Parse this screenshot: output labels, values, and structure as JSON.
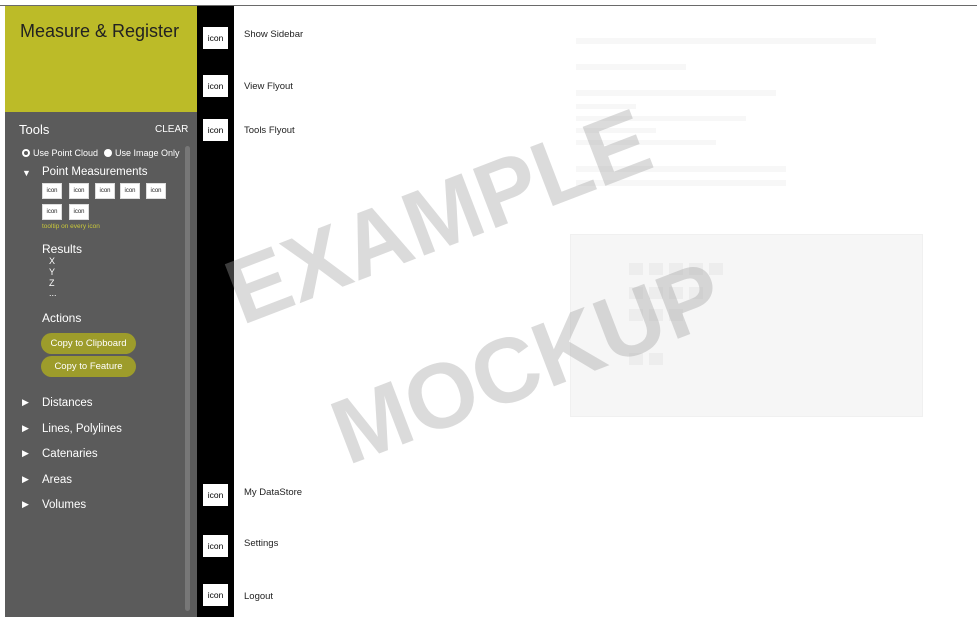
{
  "app": {
    "title": "Measure & Register"
  },
  "tools": {
    "title": "Tools",
    "clear_label": "CLEAR",
    "radio": {
      "point_cloud": "Use Point Cloud",
      "image_only": "Use Image Only",
      "selected": "Use Point Cloud"
    },
    "point_measurements": {
      "label": "Point Measurements",
      "expanded": true,
      "icon_buttons": [
        "icon",
        "icon",
        "icon",
        "icon",
        "icon",
        "icon",
        "icon"
      ],
      "tooltip_note": "tooltip on every icon"
    },
    "results": {
      "label": "Results",
      "items": [
        "X",
        "Y",
        "Z",
        "..."
      ]
    },
    "actions": {
      "label": "Actions",
      "buttons": [
        "Copy to Clipboard",
        "Copy to Feature"
      ]
    },
    "collapsed_sections": [
      "Distances",
      "Lines, Polylines",
      "Catenaries",
      "Areas",
      "Volumes"
    ]
  },
  "nav": {
    "icon_label": "icon",
    "items": [
      {
        "label": "Show Sidebar"
      },
      {
        "label": "View Flyout"
      },
      {
        "label": "Tools Flyout"
      },
      {
        "label": "My DataStore"
      },
      {
        "label": "Settings"
      },
      {
        "label": "Logout"
      }
    ]
  },
  "watermark": {
    "line1": "EXAMPLE",
    "line2": "MOCKUP"
  },
  "colors": {
    "header_olive": "#bcbb28",
    "panel_gray": "#5b5b5b",
    "accent_yellow": "#c9c83b",
    "pill_olive": "#9d9c2b"
  }
}
